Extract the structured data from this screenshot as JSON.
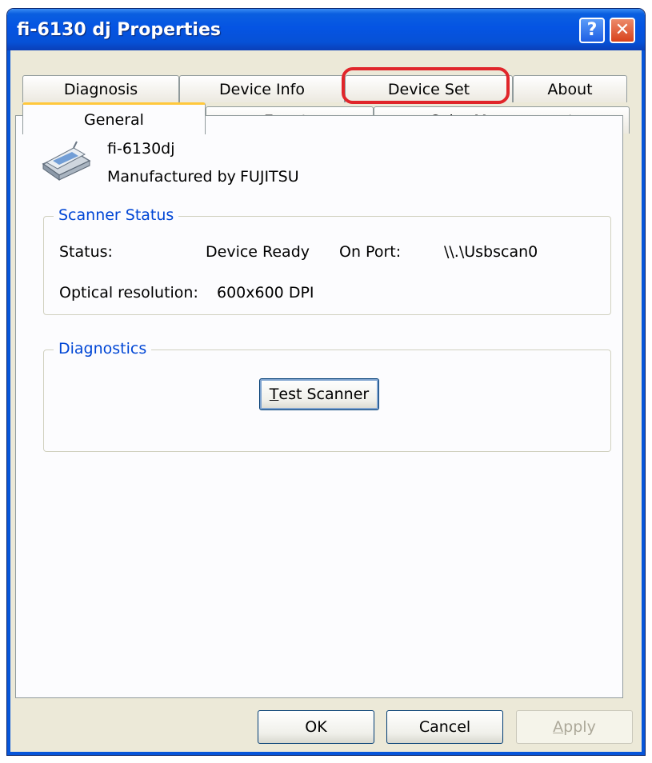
{
  "window": {
    "title": "fi-6130 dj Properties",
    "help_label": "?",
    "close_label": "✕"
  },
  "tabs": {
    "row_back": [
      "Diagnosis",
      "Device Info",
      "Device Set",
      "About"
    ],
    "row_front": [
      "General",
      "Events",
      "Color Management"
    ],
    "active": "General",
    "highlighted": "Device Set"
  },
  "general": {
    "device_icon": "scanner-icon",
    "device_name": "fi-6130dj",
    "manufacturer_label": "Manufactured by",
    "manufacturer": "FUJITSU",
    "scanner_status": {
      "group_label": "Scanner Status",
      "status_label": "Status:",
      "status_value": "Device Ready",
      "port_label": "On Port:",
      "port_value": "\\\\.\\Usbscan0",
      "resolution_label": "Optical resolution:",
      "resolution_value": "600x600 DPI"
    },
    "diagnostics": {
      "group_label": "Diagnostics",
      "test_button_mnemonic": "T",
      "test_button_rest": "est Scanner"
    }
  },
  "footer": {
    "ok_label": "OK",
    "cancel_label": "Cancel",
    "apply_mnemonic": "A",
    "apply_rest": "pply"
  },
  "colors": {
    "title_bar": "#0554e3",
    "group_label": "#0046d5",
    "highlight_ring": "#e0262b",
    "active_tab_accent": "#ffc83c"
  }
}
